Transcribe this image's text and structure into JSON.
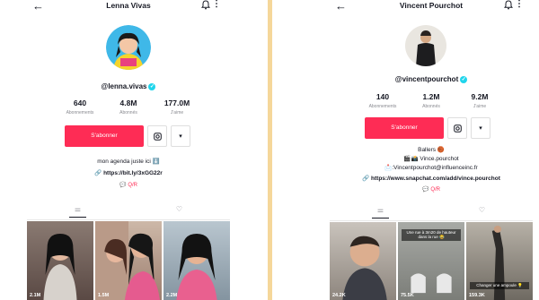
{
  "left": {
    "title": "Lenna Vivas",
    "handle": "@lenna.vivas",
    "stats": [
      {
        "value": "640",
        "label": "Abonnements"
      },
      {
        "value": "4.8M",
        "label": "Abonnés"
      },
      {
        "value": "177.0M",
        "label": "J'aime"
      }
    ],
    "follow_label": "S'abonner",
    "bio_line1": "mon agenda juste ici ⬇️",
    "link": "https://bit.ly/3xGG22r",
    "qr": "Q/R",
    "videos": [
      {
        "views": "2.1M"
      },
      {
        "views": "1.5M"
      },
      {
        "views": "2.2M"
      }
    ]
  },
  "right": {
    "title": "Vincent Pourchot",
    "handle": "@vincentpourchot",
    "stats": [
      {
        "value": "140",
        "label": "Abonnements"
      },
      {
        "value": "1.2M",
        "label": "Abonnés"
      },
      {
        "value": "9.2M",
        "label": "J'aime"
      }
    ],
    "follow_label": "S'abonner",
    "bio_line1": "Ballers 🏀",
    "bio_line2": "🎬📸 Vince.pourchot",
    "bio_line3": "📩:Vincentpourchot@influenceinc.fr",
    "link": "https://www.snapchat.com/add/vince.pourchot",
    "qr": "Q/R",
    "videos": [
      {
        "views": "24.2K",
        "caption": ""
      },
      {
        "views": "75.5K",
        "caption": "Une rue à 3m20 de hauteur dans la rue 😂"
      },
      {
        "views": "159.3K",
        "caption": "Changer une ampoule 💡"
      }
    ]
  }
}
